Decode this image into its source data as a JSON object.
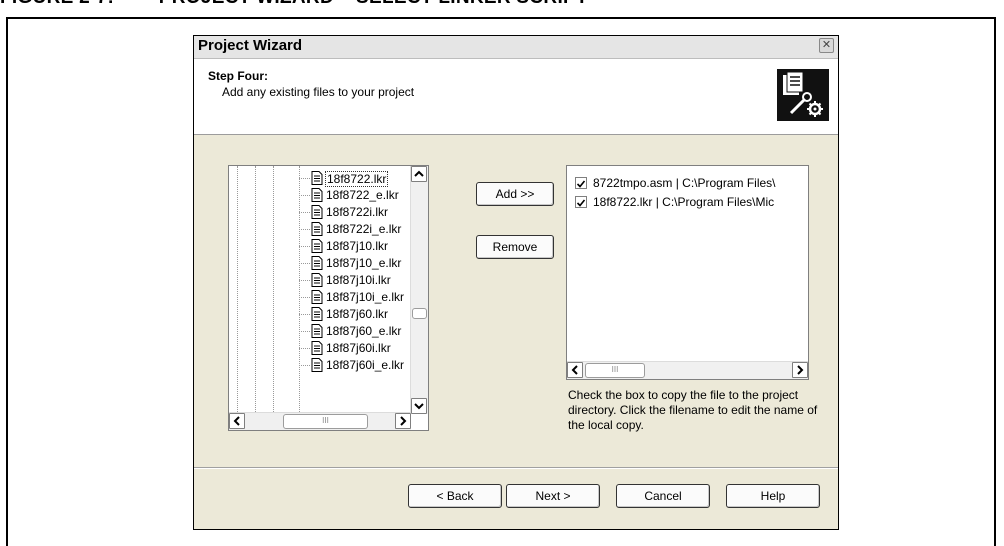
{
  "figure": {
    "title": "FIGURE 2-7:        PROJECT WIZARD – SELECT LINKER SCRIPT"
  },
  "dialog": {
    "title": "Project Wizard",
    "close_icon": "close-icon"
  },
  "header": {
    "step": "Step Four:",
    "description": "Add any existing files to your project",
    "logo_icon": "document-tools-icon"
  },
  "tree": {
    "items": [
      {
        "label": "18f8722.lkr",
        "selected": true
      },
      {
        "label": "18f8722_e.lkr",
        "selected": false
      },
      {
        "label": "18f8722i.lkr",
        "selected": false
      },
      {
        "label": "18f8722i_e.lkr",
        "selected": false
      },
      {
        "label": "18f87j10.lkr",
        "selected": false
      },
      {
        "label": "18f87j10_e.lkr",
        "selected": false
      },
      {
        "label": "18f87j10i.lkr",
        "selected": false
      },
      {
        "label": "18f87j10i_e.lkr",
        "selected": false
      },
      {
        "label": "18f87j60.lkr",
        "selected": false
      },
      {
        "label": "18f87j60_e.lkr",
        "selected": false
      },
      {
        "label": "18f87j60i.lkr",
        "selected": false
      },
      {
        "label": "18f87j60i_e.lkr",
        "selected": false
      }
    ],
    "hscroll_thumb_label": "III"
  },
  "buttons": {
    "add": "Add >>",
    "remove": "Remove",
    "back": "< Back",
    "next": "Next >",
    "cancel": "Cancel",
    "help": "Help"
  },
  "files": {
    "items": [
      {
        "checked": true,
        "label": "8722tmpo.asm | C:\\Program Files\\"
      },
      {
        "checked": true,
        "label": "18f8722.lkr | C:\\Program Files\\Mic"
      }
    ],
    "hscroll_thumb_label": "III"
  },
  "help_text": "Check the box to copy the file to the project directory.  Click the filename to edit the name of the local copy."
}
